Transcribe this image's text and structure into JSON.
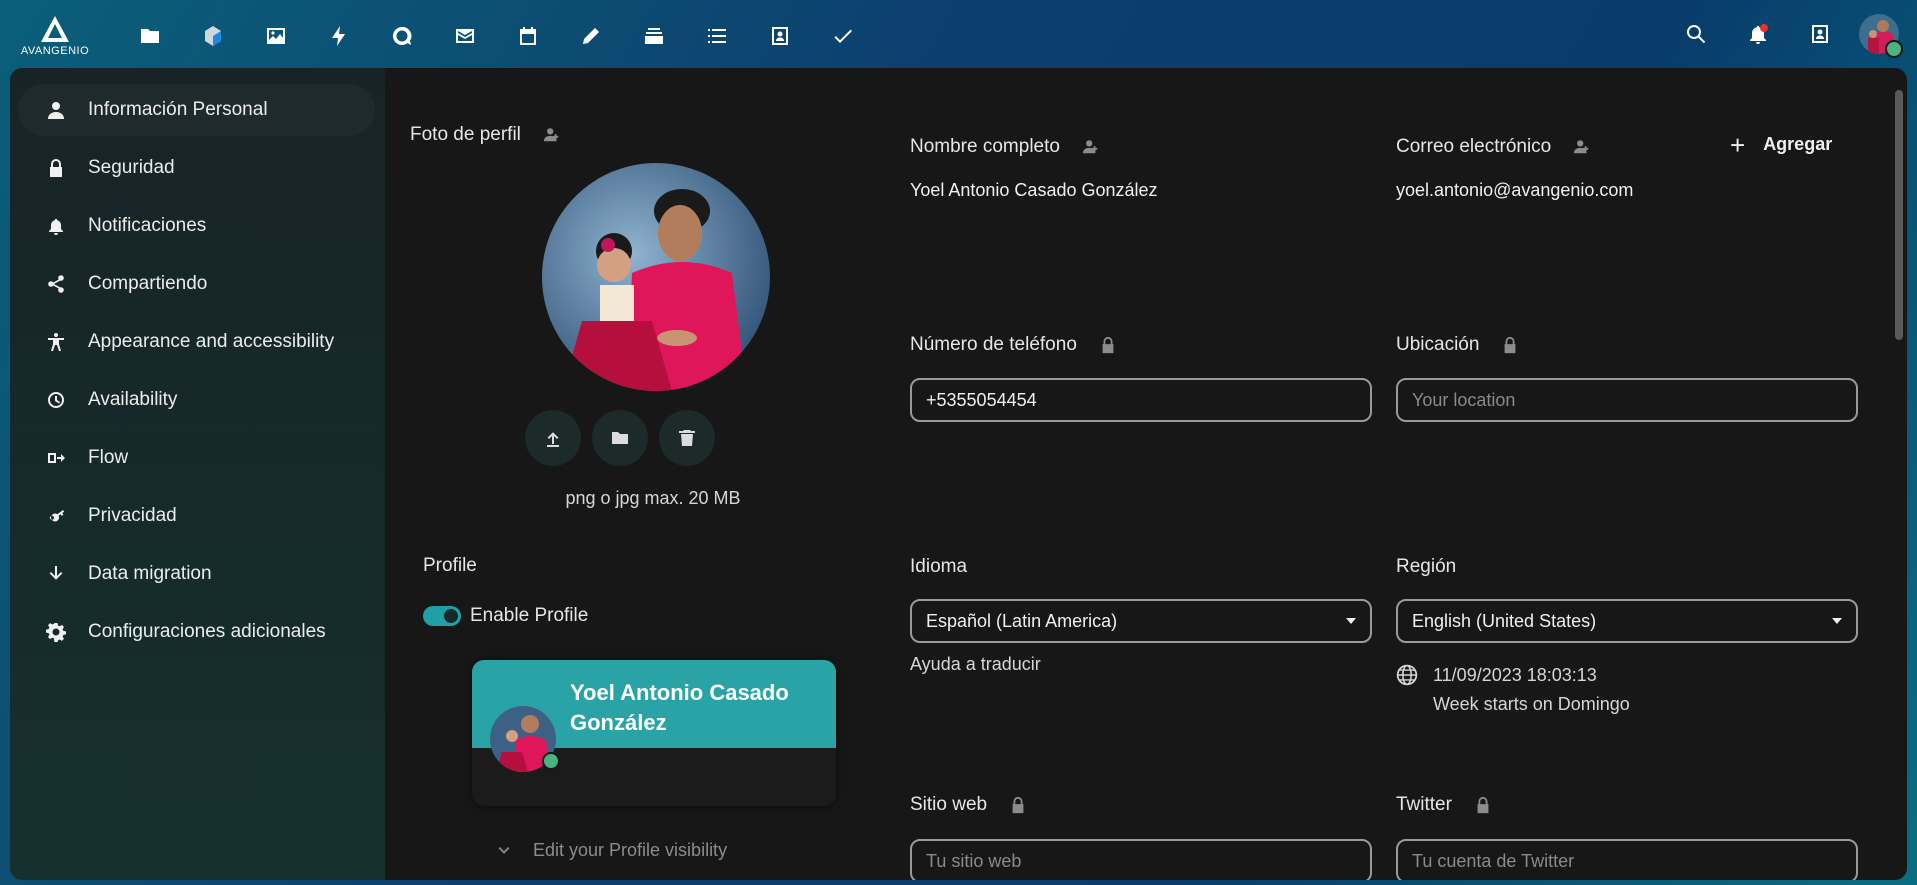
{
  "header": {
    "logo_text": "AVANGENIO",
    "apps": [
      {
        "icon": "folder-icon"
      },
      {
        "icon": "photos-stack-icon"
      },
      {
        "icon": "image-icon"
      },
      {
        "icon": "activity-bolt-icon"
      },
      {
        "icon": "talk-icon"
      },
      {
        "icon": "mail-icon"
      },
      {
        "icon": "calendar-icon"
      },
      {
        "icon": "notes-pencil-icon"
      },
      {
        "icon": "deck-icon"
      },
      {
        "icon": "list-icon"
      },
      {
        "icon": "contacts-icon"
      },
      {
        "icon": "tasks-check-icon"
      }
    ],
    "right": [
      {
        "icon": "search-icon"
      },
      {
        "icon": "bell-icon"
      },
      {
        "icon": "contacts-menu-icon"
      }
    ]
  },
  "sidebar": {
    "items": [
      {
        "label": "Información Personal",
        "icon": "user-icon",
        "active": true
      },
      {
        "label": "Seguridad",
        "icon": "lock-icon"
      },
      {
        "label": "Notificaciones",
        "icon": "bell-icon"
      },
      {
        "label": "Compartiendo",
        "icon": "share-icon"
      },
      {
        "label": "Appearance and accessibility",
        "icon": "accessibility-icon"
      },
      {
        "label": "Availability",
        "icon": "clock-icon"
      },
      {
        "label": "Flow",
        "icon": "flow-icon"
      },
      {
        "label": "Privacidad",
        "icon": "key-icon"
      },
      {
        "label": "Data migration",
        "icon": "download-arrow-icon"
      },
      {
        "label": "Configuraciones adicionales",
        "icon": "gear-icon"
      }
    ]
  },
  "profile_photo": {
    "label": "Foto de perfil",
    "hint": "png o jpg max. 20 MB"
  },
  "profile": {
    "heading": "Profile",
    "enable_label": "Enable Profile",
    "enabled": true,
    "card_name": "Yoel Antonio Casado González",
    "visibility_label": "Edit your Profile visibility"
  },
  "fields": {
    "full_name": {
      "label": "Nombre completo",
      "value": "Yoel Antonio Casado González"
    },
    "email": {
      "label": "Correo electrónico",
      "value": "yoel.antonio@avangenio.com",
      "add_label": "Agregar"
    },
    "phone": {
      "label": "Número de teléfono",
      "value": "+5355054454"
    },
    "location": {
      "label": "Ubicación",
      "placeholder": "Your location"
    },
    "language": {
      "label": "Idioma",
      "value": "Español (Latin America)",
      "help": "Ayuda a traducir"
    },
    "region": {
      "label": "Región",
      "value": "English (United States)",
      "datetime": "11/09/2023 18:03:13",
      "week_start": "Week starts on Domingo"
    },
    "website": {
      "label": "Sitio web",
      "placeholder": "Tu sitio web"
    },
    "twitter": {
      "label": "Twitter",
      "placeholder": "Tu cuenta de Twitter"
    }
  }
}
